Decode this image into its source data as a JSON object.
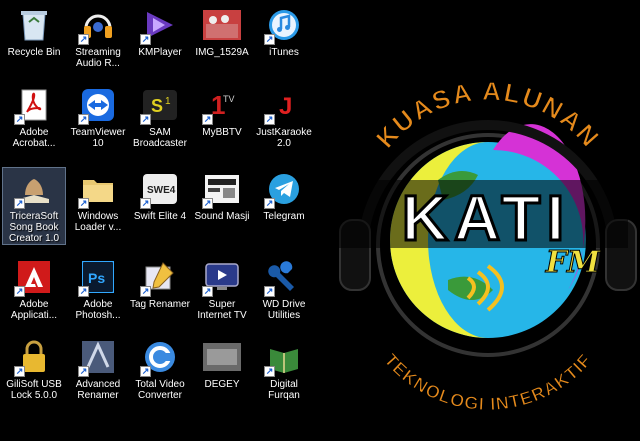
{
  "desktop": {
    "icons": [
      {
        "label": "Recycle Bin",
        "icon": "recycle-bin-icon",
        "shortcut": false
      },
      {
        "label": "Streaming Audio R...",
        "icon": "headphones-icon",
        "shortcut": true
      },
      {
        "label": "KMPlayer",
        "icon": "kmplayer-icon",
        "shortcut": true
      },
      {
        "label": "IMG_1529A",
        "icon": "photo-thumbnail-icon",
        "shortcut": false
      },
      {
        "label": "iTunes",
        "icon": "itunes-icon",
        "shortcut": true
      },
      {
        "label": "Adobe Acrobat...",
        "icon": "acrobat-icon",
        "shortcut": true
      },
      {
        "label": "TeamViewer 10",
        "icon": "teamviewer-icon",
        "shortcut": true
      },
      {
        "label": "SAM Broadcaster",
        "icon": "sam-broadcaster-icon",
        "shortcut": true
      },
      {
        "label": "MyBBTV",
        "icon": "mybbtv-icon",
        "shortcut": true
      },
      {
        "label": "JustKaraoke 2.0",
        "icon": "justkaraoke-icon",
        "shortcut": true
      },
      {
        "label": "TriceraSoft Song Book Creator 1.0",
        "icon": "songbook-icon",
        "shortcut": true
      },
      {
        "label": "Windows Loader v...",
        "icon": "folder-icon",
        "shortcut": true
      },
      {
        "label": "Swift Elite 4",
        "icon": "swift-elite-icon",
        "shortcut": true
      },
      {
        "label": "Sound Masji",
        "icon": "sound-masji-icon",
        "shortcut": true
      },
      {
        "label": "Telegram",
        "icon": "telegram-icon",
        "shortcut": true
      },
      {
        "label": "Adobe Applicati...",
        "icon": "adobe-icon",
        "shortcut": true
      },
      {
        "label": "Adobe Photosh...",
        "icon": "photoshop-icon",
        "shortcut": true
      },
      {
        "label": "Tag Renamer",
        "icon": "tag-renamer-icon",
        "shortcut": true
      },
      {
        "label": "Super Internet TV",
        "icon": "internet-tv-icon",
        "shortcut": true
      },
      {
        "label": "WD Drive Utilities",
        "icon": "wrench-icon",
        "shortcut": true
      },
      {
        "label": "GiliSoft USB Lock 5.0.0",
        "icon": "usb-lock-icon",
        "shortcut": true
      },
      {
        "label": "Advanced Renamer",
        "icon": "advanced-renamer-icon",
        "shortcut": true
      },
      {
        "label": "Total Video Converter",
        "icon": "video-converter-icon",
        "shortcut": true
      },
      {
        "label": "DEGEY",
        "icon": "degey-thumbnail-icon",
        "shortcut": false
      },
      {
        "label": "Digital Furqan",
        "icon": "quran-icon",
        "shortcut": true
      }
    ]
  },
  "wallpaper": {
    "arc_top": "KUASA ALUNAN",
    "main": "KATI",
    "fm": "FM",
    "arc_bottom": "TEKNOLOGI INTERAKTIF"
  },
  "colors": {
    "background": "#000000",
    "arc_text": "#e58a1c",
    "globe_yellow": "#ecef3c",
    "globe_cyan": "#26b6e8",
    "globe_magenta": "#d532d6"
  }
}
